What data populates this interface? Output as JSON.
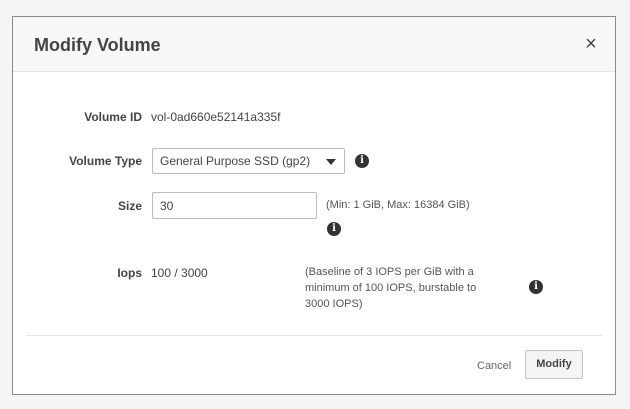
{
  "dialog": {
    "title": "Modify Volume",
    "close_glyph": "×"
  },
  "fields": {
    "volume_id": {
      "label": "Volume ID",
      "value": "vol-0ad660e52141a335f"
    },
    "volume_type": {
      "label": "Volume Type",
      "selected": "General Purpose SSD (gp2)"
    },
    "size": {
      "label": "Size",
      "value": "30",
      "hint": "(Min: 1 GiB, Max: 16384 GiB)"
    },
    "iops": {
      "label": "Iops",
      "value": "100 / 3000",
      "hint_lines": [
        "(Baseline of 3 IOPS per GiB with a",
        "minimum of 100 IOPS, burstable to",
        "3000 IOPS)"
      ]
    }
  },
  "footer": {
    "cancel_label": "Cancel",
    "modify_label": "Modify"
  },
  "icons": {
    "info": "info-icon",
    "close": "close-icon",
    "dropdown": "chevron-down-icon"
  }
}
